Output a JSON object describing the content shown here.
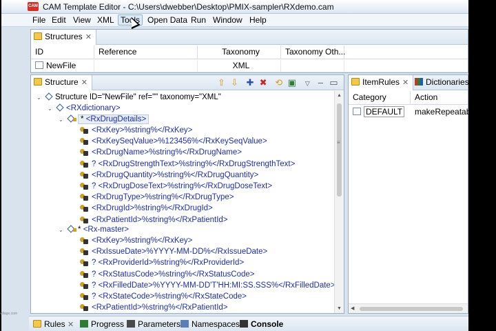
{
  "window": {
    "title": "CAM Template Editor - C:\\Users\\dwebber\\Desktop\\PMIX-sampler\\RXdemo.cam",
    "app_icon_text": "CAM"
  },
  "menu": [
    "File",
    "Edit",
    "View",
    "XML",
    "Tools",
    "Open Data",
    "Run",
    "Window",
    "Help"
  ],
  "structures": {
    "tab": "Structures",
    "columns": [
      "ID",
      "Reference",
      "Taxonomy",
      "Taxonomy Oth..."
    ],
    "rows": [
      {
        "id": "NewFile",
        "reference": "",
        "taxonomy": "XML",
        "taxonomy_other": ""
      }
    ]
  },
  "structure_view": {
    "tab": "Structure",
    "root": "Structure ID=\"NewFile\" ref=\"\" taxonomy=\"XML\"",
    "dictionary": "<RXdictionary>",
    "groups": [
      {
        "label": "<RxDrugDetails>",
        "prefix": "*",
        "items": [
          "<RxKey>%string%</RxKey>",
          "<RxKeySeqValue>%123456%</RxKeySeqValue>",
          "<RxDrugName>%string%</RxDrugName>",
          "? <RxDrugStrengthText>%string%</RxDrugStrengthText>",
          "<RxDrugQuantity>%string%</RxDrugQuantity>",
          "? <RxDrugDoseText>%string%</RxDrugDoseText>",
          "<RxDrugType>%string%</RxDrugType>",
          "<RxDrugId>%string%</RxDrugId>",
          "<RxPatientId>%string%</RxPatientId>"
        ]
      },
      {
        "label": "<Rx-master>",
        "prefix": "*",
        "items": [
          "<RxKey>%string%</RxKey>",
          "<RxIssueDate>%YYYY-MM-DD%</RxIssueDate>",
          "? <RxProviderId>%string%</RxProviderId>",
          "? <RxStatusCode>%string%</RxStatusCode>",
          "? <RxFilledDate>%YYYY-MM-DD'T'HH:MI:SS.SSS%</RxFilledDate>",
          "? <RxStateCode>%string%</RxStateCode>",
          "<RxPatientId>%string%</RxPatientId>"
        ]
      }
    ]
  },
  "item_rules": {
    "tabs": [
      "ItemRules",
      "Dictionaries"
    ],
    "columns": [
      "Category",
      "Action"
    ],
    "rows": [
      {
        "category": "DEFAULT",
        "action": "makeRepeatable"
      }
    ]
  },
  "bottom_tabs": [
    "Rules",
    "Progress",
    "Parameters",
    "Namespaces",
    "Console"
  ],
  "watermark": "village.com",
  "colors": {
    "accent": "#1d2fa6",
    "background": "#d9e3ee"
  }
}
